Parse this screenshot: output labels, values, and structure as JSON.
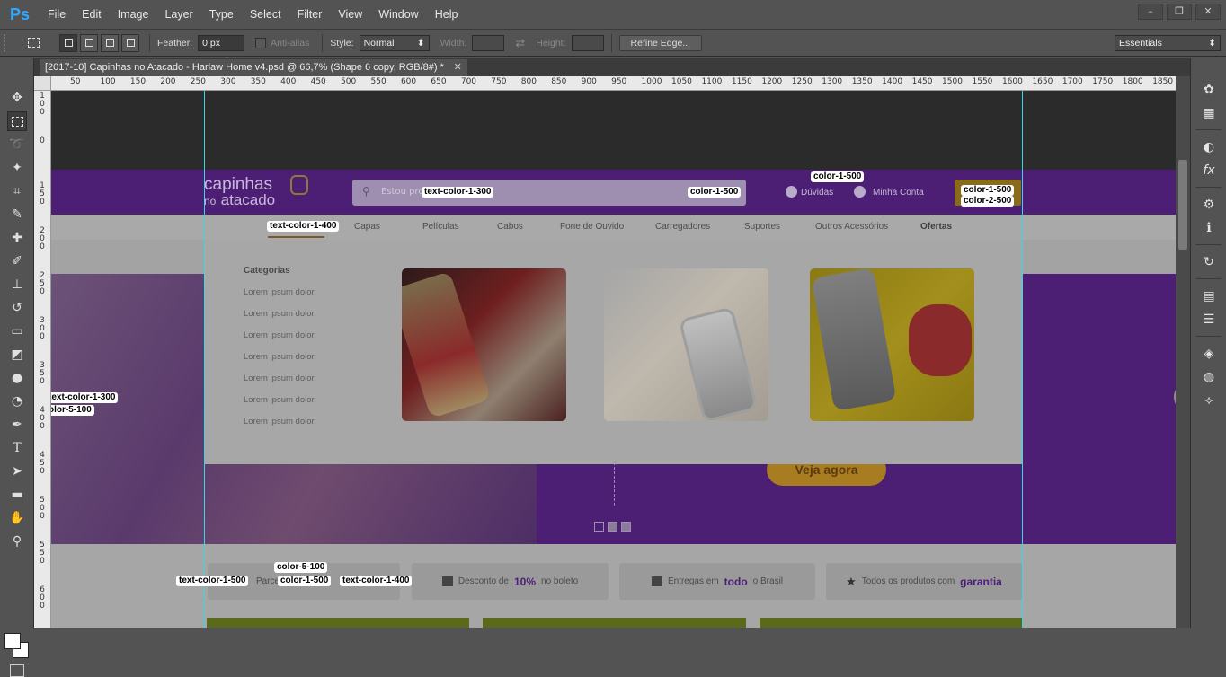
{
  "app": {
    "logo": "Ps"
  },
  "menu": [
    "File",
    "Edit",
    "Image",
    "Layer",
    "Type",
    "Select",
    "Filter",
    "View",
    "Window",
    "Help"
  ],
  "window_controls": [
    "–",
    "❐",
    "✕"
  ],
  "options": {
    "feather_label": "Feather:",
    "feather_value": "0 px",
    "antialias_label": "Anti-alias",
    "style_label": "Style:",
    "style_value": "Normal",
    "width_label": "Width:",
    "height_label": "Height:",
    "refine_label": "Refine Edge...",
    "workspace": "Essentials"
  },
  "document_tab": {
    "title": "[2017-10] Capinhas no Atacado - Harlaw Home v4.psd @ 66,7% (Shape 6 copy, RGB/8#) *",
    "close": "✕"
  },
  "ruler_top": [
    "50",
    "100",
    "150",
    "200",
    "250",
    "300",
    "350",
    "400",
    "450",
    "500",
    "550",
    "600",
    "650",
    "700",
    "750",
    "800",
    "850",
    "900",
    "950",
    "1000",
    "1050",
    "1100",
    "1150",
    "1200",
    "1250",
    "1300",
    "1350",
    "1400",
    "1450",
    "1500",
    "1550",
    "1600",
    "1650",
    "1700",
    "1750",
    "1800",
    "1850"
  ],
  "ruler_left": [
    "100",
    "0",
    "150",
    "200",
    "250",
    "300",
    "350",
    "400",
    "450",
    "500",
    "550",
    "600",
    "650"
  ],
  "design": {
    "logo_line1": "capinhas",
    "logo_line2a": "no",
    "logo_line2b": "atacado",
    "search_placeholder": "Estou procurando",
    "help_link": "Dúvidas",
    "account_link": "Minha Conta",
    "nav": [
      "Capas",
      "Películas",
      "Cabos",
      "Fone de Ouvido",
      "Carregadores",
      "Suportes",
      "Outros Acessórios",
      "Ofertas"
    ],
    "megamenu_title": "Categorias",
    "megamenu_links": [
      "Lorem ipsum dolor",
      "Lorem ipsum dolor",
      "Lorem ipsum dolor",
      "Lorem ipsum dolor",
      "Lorem ipsum dolor",
      "Lorem ipsum dolor",
      "Lorem ipsum dolor"
    ],
    "hero_button": "Veja agora",
    "benefit1": "Parce",
    "benefit2_pre": "Desconto de",
    "benefit2_bold": "10%",
    "benefit2_post": "no boleto",
    "benefit3_pre": "Entregas em",
    "benefit3_bold": "todo",
    "benefit3_post": "o Brasil",
    "benefit4_pre": "Todos os produtos com",
    "benefit4_bold": "garantia"
  },
  "tags": {
    "t1": "color-1-500",
    "t2": "text-color-1-300",
    "t3": "color-1-500",
    "t4": "color-1-500",
    "t5": "color-2-500",
    "t6": "text-color-1-400",
    "t7": "text-color-1-300",
    "t8": "olor-5-100",
    "t9": "color-5-100",
    "t10": "text-color-1-500",
    "t11": "color-1-500",
    "t12": "text-color-1-400"
  },
  "colors": {
    "brand_purple": "#4c1f75",
    "guide_cyan": "#3ad7e8",
    "ps_blue": "#31a8ff"
  }
}
